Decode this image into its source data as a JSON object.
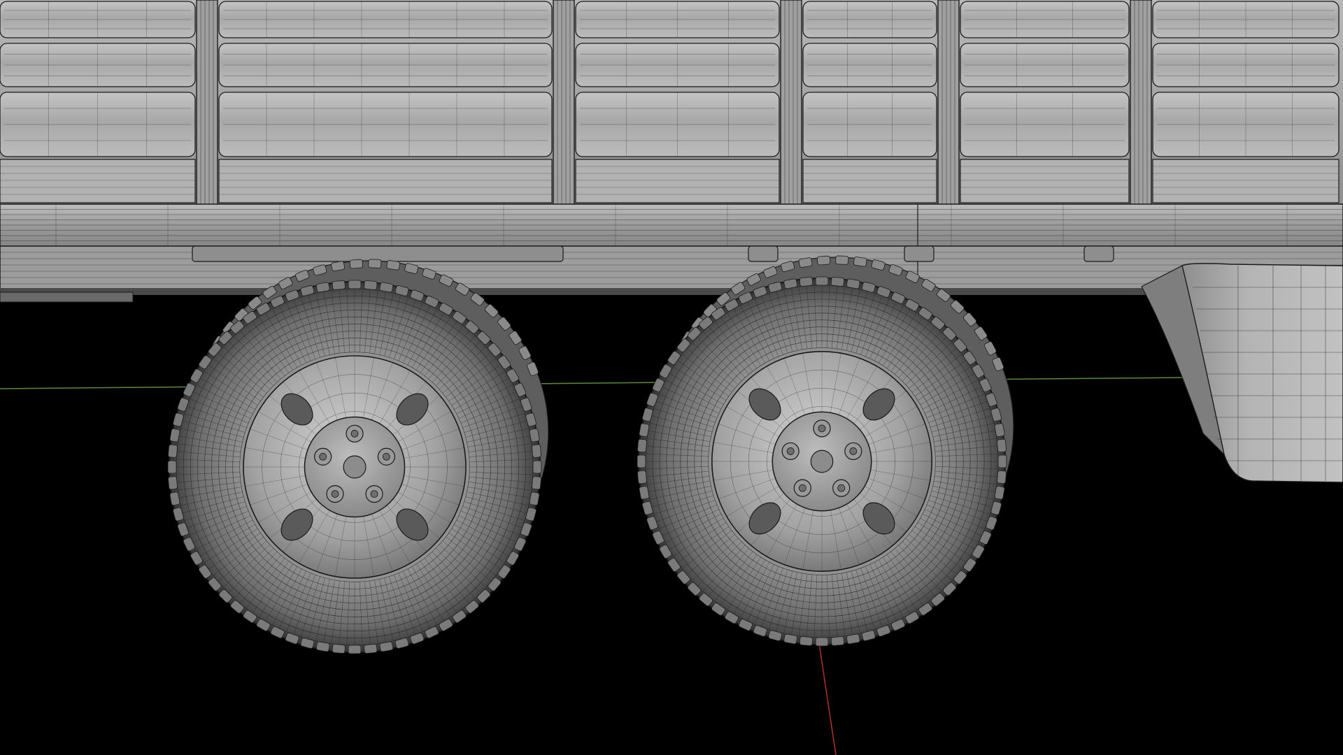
{
  "viewport": {
    "background_color": "#000000",
    "mesh_fill_color": "#a9a9a9",
    "mesh_fill_dark": "#7f7f7f",
    "mesh_fill_light": "#c6c6c6",
    "wire_color": "#1a1a1a",
    "grid_axis_x_color": "#5d8a3a",
    "grid_axis_z_color": "#b03030",
    "display_mode": "wireframe-on-shaded"
  },
  "scene": {
    "subject": "truck-trailer",
    "wheel_count_visible": 2,
    "lug_nut_count_per_wheel": 5,
    "wheel_hole_count_per_wheel": 4,
    "panel_columns": 6,
    "panel_rows": 3
  },
  "icons": {
    "mesh": "mesh-wireframe-icon"
  }
}
